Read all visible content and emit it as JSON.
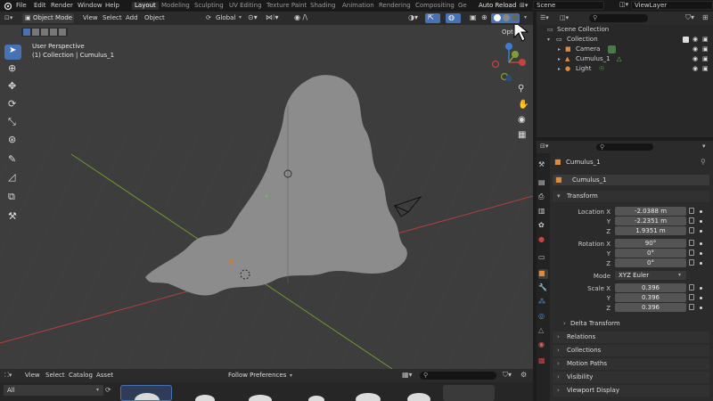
{
  "topbar": {
    "menus": [
      "File",
      "Edit",
      "Render",
      "Window",
      "Help"
    ],
    "workspaces": [
      "Layout",
      "Modeling",
      "Sculpting",
      "UV Editing",
      "Texture Paint",
      "Shading",
      "Animation",
      "Rendering",
      "Compositing",
      "Ge"
    ],
    "active_workspace": "Layout",
    "auto_reload": "Auto Reload",
    "scene": "Scene",
    "view_layer": "ViewLayer"
  },
  "viewport_header": {
    "mode": "Object Mode",
    "menus": [
      "View",
      "Select",
      "Add",
      "Object"
    ],
    "orientation": "Global",
    "options_label": "Opti"
  },
  "viewport": {
    "perspective_label": "User Perspective",
    "collection_label": "(1) Collection | Cumulus_1",
    "cloud_color": "#8c8c8c",
    "background_color": "#3d3d3d"
  },
  "outliner": {
    "root": "Scene Collection",
    "collection": "Collection",
    "items": [
      "Camera",
      "Cumulus_1",
      "Light"
    ]
  },
  "properties": {
    "object_name": "Cumulus_1",
    "object_field": "Cumulus_1",
    "transform_header": "Transform",
    "location_label": "Location X",
    "rotation_label": "Rotation X",
    "scale_label": "Scale X",
    "y_label": "Y",
    "z_label": "Z",
    "mode_label": "Mode",
    "location": [
      "-2.0388 m",
      "-2.2351 m",
      "1.9351 m"
    ],
    "rotation": [
      "90°",
      "0°",
      "0°"
    ],
    "mode_value": "XYZ Euler",
    "scale": [
      "0.396",
      "0.396",
      "0.396"
    ],
    "delta_transform": "Delta Transform",
    "panels": [
      "Relations",
      "Collections",
      "Motion Paths",
      "Visibility",
      "Viewport Display"
    ]
  },
  "asset_browser": {
    "menus": [
      "View",
      "Select",
      "Catalog",
      "Asset"
    ],
    "import_method": "Follow Preferences",
    "library": "All"
  },
  "colors": {
    "accent_blue": "#4772b3",
    "axis_x_red": "#c8423e",
    "axis_y_green": "#7da035",
    "axis_z_blue": "#3c7dd1"
  }
}
